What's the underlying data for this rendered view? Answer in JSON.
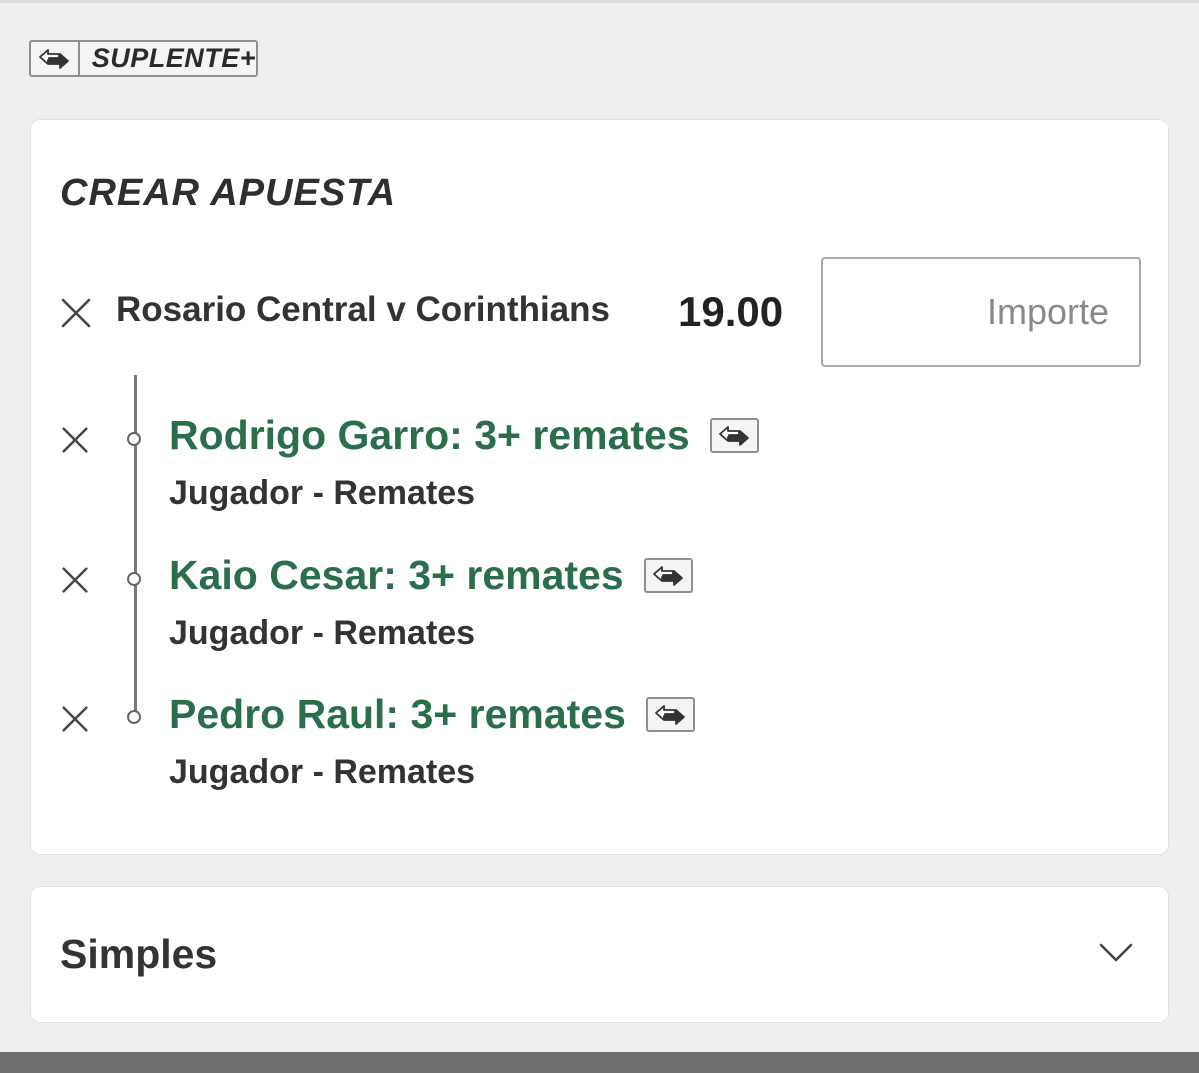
{
  "substitute_badge": {
    "label": "SUPLENTE+",
    "icon": "substitute-swap-icon"
  },
  "bet_builder": {
    "title": "CREAR APUESTA",
    "event": {
      "name": "Rosario Central v Corinthians",
      "odds": "19.00",
      "remove_icon": "close-icon"
    },
    "stake_input": {
      "placeholder": "Importe",
      "value": ""
    },
    "selections": [
      {
        "title": "Rodrigo Garro: 3+ remates",
        "market": "Jugador - Remates",
        "substitute_icon": "substitute-swap-icon"
      },
      {
        "title": "Kaio Cesar: 3+ remates",
        "market": "Jugador - Remates",
        "substitute_icon": "substitute-swap-icon"
      },
      {
        "title": "Pedro Raul: 3+ remates",
        "market": "Jugador - Remates",
        "substitute_icon": "substitute-swap-icon"
      }
    ]
  },
  "simples": {
    "label": "Simples",
    "expand_icon": "chevron-down-icon"
  },
  "colors": {
    "background": "#efefef",
    "selection_green": "#2a6e4b",
    "text_dark": "#333333",
    "border_gray": "#a9a9a9"
  }
}
